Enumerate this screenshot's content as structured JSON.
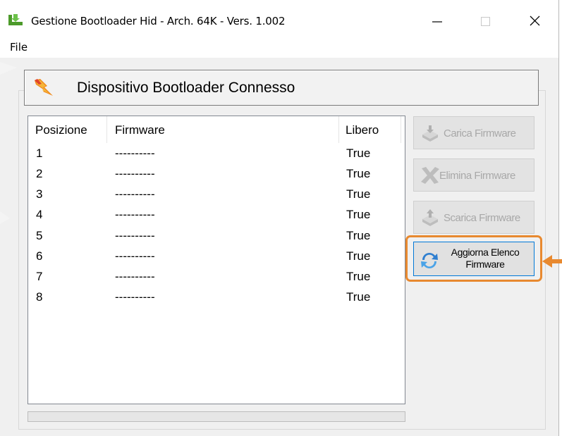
{
  "window": {
    "title": "Gestione Bootloader Hid - Arch. 64K - Vers. 1.002",
    "icons": {
      "app": "bootloader-app-icon",
      "minimize": "minimize-icon",
      "maximize": "maximize-icon",
      "close": "close-icon"
    }
  },
  "menu": {
    "file": "File"
  },
  "banner": {
    "title": "Dispositivo Bootloader Connesso",
    "icon": "device-connected-icon"
  },
  "table": {
    "columns": [
      "Posizione",
      "Firmware",
      "Libero"
    ],
    "rows": [
      [
        "1",
        "----------",
        "True"
      ],
      [
        "2",
        "----------",
        "True"
      ],
      [
        "3",
        "----------",
        "True"
      ],
      [
        "4",
        "----------",
        "True"
      ],
      [
        "5",
        "----------",
        "True"
      ],
      [
        "6",
        "----------",
        "True"
      ],
      [
        "7",
        "----------",
        "True"
      ],
      [
        "8",
        "----------",
        "True"
      ]
    ]
  },
  "buttons": {
    "load": {
      "label": "Carica Firmware",
      "icon": "upload-firmware-icon",
      "enabled": false
    },
    "delete": {
      "label": "Elimina Firmware",
      "icon": "delete-x-icon",
      "enabled": false
    },
    "download": {
      "label": "Scarica Firmware",
      "icon": "download-firmware-icon",
      "enabled": false
    },
    "refresh": {
      "label_line1": "Aggiorna Elenco",
      "label_line2": "Firmware",
      "icon": "refresh-icon",
      "enabled": true
    }
  },
  "progress": {
    "value": 0
  },
  "annotation": {
    "highlight_color": "#e8892f",
    "target": "refresh-button"
  },
  "colors": {
    "accent": "#0078d7",
    "highlight": "#e8892f",
    "disabled_text": "#a8a8a8"
  }
}
